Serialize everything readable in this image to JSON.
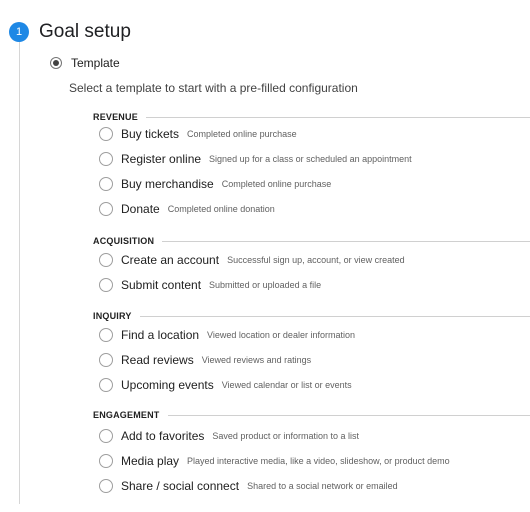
{
  "step": {
    "number": "1",
    "title": "Goal setup"
  },
  "template_option": {
    "label": "Template",
    "selected": true
  },
  "subtitle": "Select a template to start with a pre-filled configuration",
  "categories": [
    {
      "name": "REVENUE",
      "options": [
        {
          "label": "Buy tickets",
          "desc": "Completed online purchase"
        },
        {
          "label": "Register online",
          "desc": "Signed up for a class or scheduled an appointment"
        },
        {
          "label": "Buy merchandise",
          "desc": "Completed online purchase"
        },
        {
          "label": "Donate",
          "desc": "Completed online donation"
        }
      ]
    },
    {
      "name": "ACQUISITION",
      "options": [
        {
          "label": "Create an account",
          "desc": "Successful sign up, account, or view created"
        },
        {
          "label": "Submit content",
          "desc": "Submitted or uploaded a file"
        }
      ]
    },
    {
      "name": "INQUIRY",
      "options": [
        {
          "label": "Find a location",
          "desc": "Viewed location or dealer information"
        },
        {
          "label": "Read reviews",
          "desc": "Viewed reviews and ratings"
        },
        {
          "label": "Upcoming events",
          "desc": "Viewed calendar or list or events"
        }
      ]
    },
    {
      "name": "ENGAGEMENT",
      "options": [
        {
          "label": "Add to favorites",
          "desc": "Saved product or information to a list"
        },
        {
          "label": "Media play",
          "desc": "Played interactive media, like a video, slideshow, or product demo"
        },
        {
          "label": "Share / social connect",
          "desc": "Shared to a social network or emailed"
        }
      ]
    }
  ],
  "colors": {
    "accent": "#1e88e5",
    "divider": "#d0d0d0",
    "text": "#212121",
    "muted": "#616161"
  }
}
